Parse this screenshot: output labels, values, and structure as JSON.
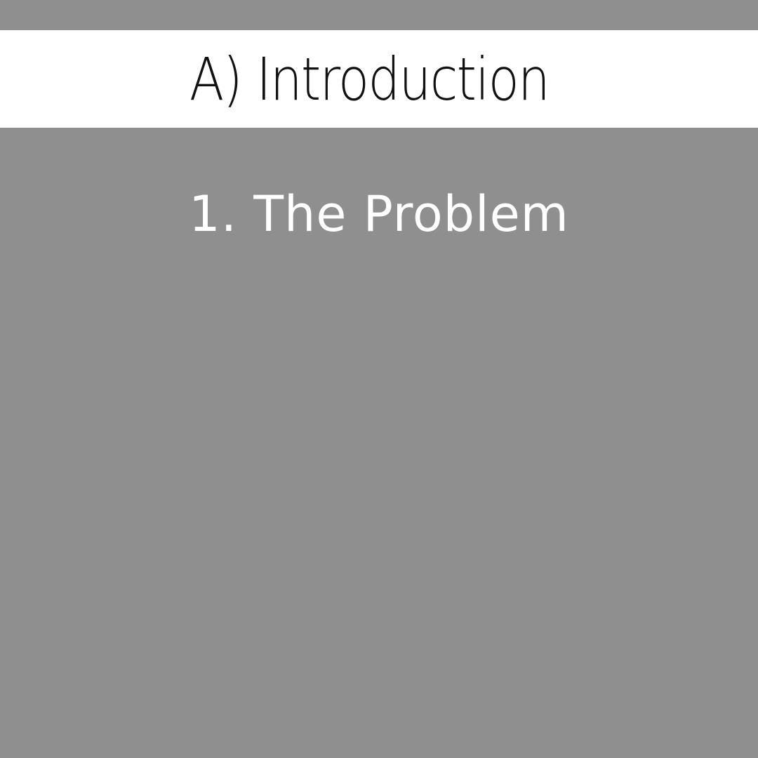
{
  "header": {
    "title": "A) Introduction"
  },
  "main": {
    "subtitle": "1. The Problem"
  },
  "colors": {
    "background": "#8f8f8f",
    "header_band": "#ffffff",
    "title_text": "#111111",
    "subtitle_text": "#ffffff"
  }
}
